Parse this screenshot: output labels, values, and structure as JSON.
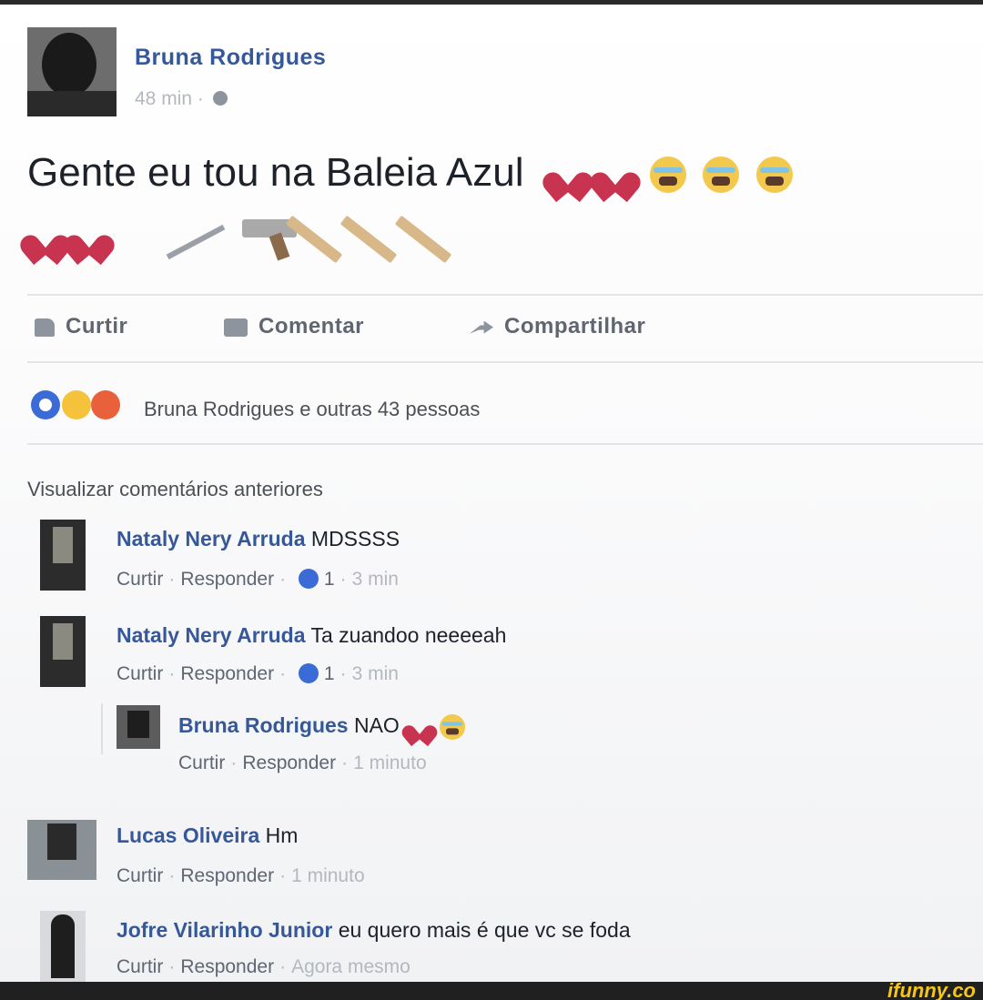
{
  "post": {
    "author": "Bruna Rodrigues",
    "time": "48 min ·",
    "text": "Gente eu tou na Baleia Azul"
  },
  "actions": {
    "like": "Curtir",
    "comment": "Comentar",
    "share": "Compartilhar"
  },
  "reactions": {
    "summary": "Bruna Rodrigues e outras 43 pessoas"
  },
  "comments_header": {
    "view_previous": "Visualizar comentários anteriores"
  },
  "comments": [
    {
      "author": "Nataly Nery Arruda",
      "text": "MDSSSS",
      "like_label": "Curtir",
      "reply_label": "Responder",
      "like_count": "1",
      "time": "3 min"
    },
    {
      "author": "Nataly Nery Arruda",
      "text": "Ta zuandoo neeeeah",
      "like_label": "Curtir",
      "reply_label": "Responder",
      "like_count": "1",
      "time": "3 min"
    },
    {
      "author": "Bruna Rodrigues",
      "text": "NAO",
      "like_label": "Curtir",
      "reply_label": "Responder",
      "time": "1 minuto"
    },
    {
      "author": "Lucas Oliveira",
      "text": "Hm",
      "like_label": "Curtir",
      "reply_label": "Responder",
      "time": "1 minuto"
    },
    {
      "author": "Jofre Vilarinho Junior",
      "text": "eu quero mais é que vc se foda",
      "like_label": "Curtir",
      "reply_label": "Responder",
      "time": "Agora mesmo"
    }
  ],
  "watermark": "ifunny.co",
  "icons": [
    "globe-icon",
    "broken-heart-emoji",
    "crying-face-emoji",
    "knife-emoji",
    "pistol-emoji",
    "wooden-stick-emoji",
    "like-thumb-icon",
    "comment-bubble-icon",
    "share-arrow-icon",
    "like-reaction-icon",
    "wow-reaction-icon",
    "angry-reaction-icon"
  ],
  "colors": {
    "name_link": "#365899",
    "muted": "#b4b8be",
    "reaction_like": "#3b6bd6"
  }
}
